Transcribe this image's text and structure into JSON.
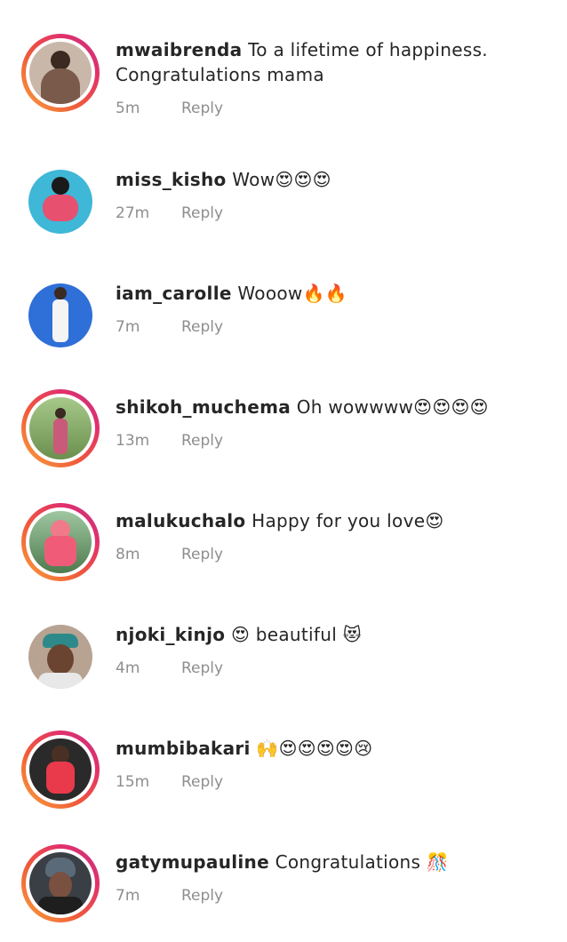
{
  "comments": [
    {
      "user": "mwaibrenda",
      "text": "To a lifetime of happiness. Congratulations mama",
      "time": "5m",
      "reply": "Reply",
      "avatar": "woman-in-brown-dress-avatar",
      "story": true
    },
    {
      "user": "miss_kisho",
      "text": "Wow😍😍😍",
      "time": "27m",
      "reply": "Reply",
      "avatar": "woman-by-pool-avatar",
      "story": false
    },
    {
      "user": "iam_carolle",
      "text": "Wooow🔥🔥",
      "time": "7m",
      "reply": "Reply",
      "avatar": "woman-in-white-on-blue-avatar",
      "story": false
    },
    {
      "user": "shikoh_muchema",
      "text": "Oh wowwww😍😍😍😍",
      "time": "13m",
      "reply": "Reply",
      "avatar": "woman-in-field-avatar",
      "story": true
    },
    {
      "user": "malukuchalo",
      "text": "Happy for you love😍",
      "time": "8m",
      "reply": "Reply",
      "avatar": "person-in-pink-hoodie-avatar",
      "story": true
    },
    {
      "user": "njoki_kinjo",
      "text": "😍 beautiful 😻",
      "time": "4m",
      "reply": "Reply",
      "avatar": "woman-with-headwrap-avatar",
      "story": false
    },
    {
      "user": "mumbibakari",
      "text": "🙌😍😍😍😍😢",
      "time": "15m",
      "reply": "Reply",
      "avatar": "woman-in-red-top-avatar",
      "story": true
    },
    {
      "user": "gatymupauline",
      "text": "Congratulations 🎊",
      "time": "7m",
      "reply": "Reply",
      "avatar": "woman-in-turban-avatar",
      "story": true
    }
  ]
}
